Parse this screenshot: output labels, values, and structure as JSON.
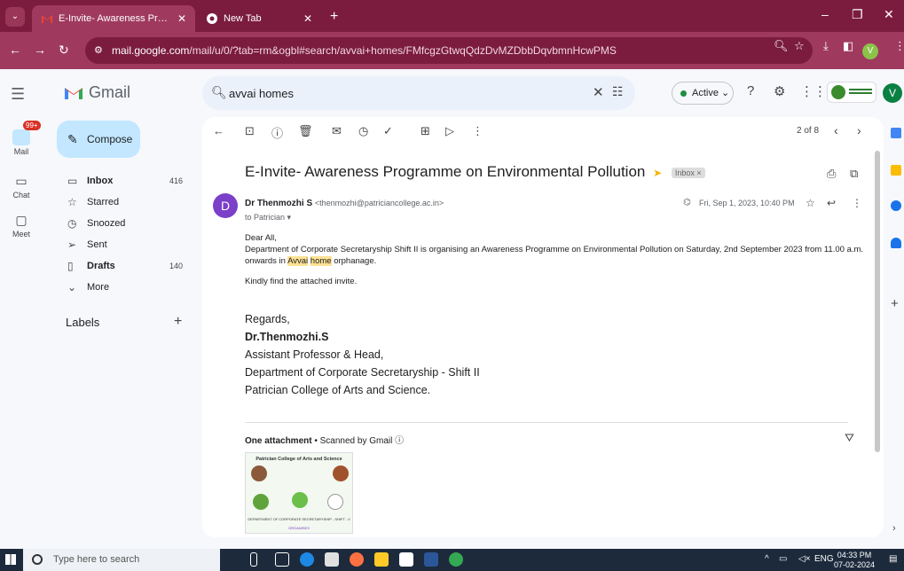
{
  "browser": {
    "tabs": [
      {
        "title": "E-Invite- Awareness Programme",
        "active": true
      },
      {
        "title": "New Tab",
        "active": false
      }
    ],
    "url_host": "mail.google.com",
    "url_path": "/mail/u/0/?tab=rm&ogbl#search/avvai+homes/FMfcgzGtwqQdzDvMZDbbDqvbmnHcwPMS",
    "profile_initial": "V"
  },
  "gmail": {
    "brand": "Gmail",
    "search_value": "avvai homes",
    "status": "Active",
    "avatar": "V",
    "compose": "Compose",
    "rail": {
      "mail": "Mail",
      "mail_badge": "99+",
      "chat": "Chat",
      "meet": "Meet"
    },
    "nav": [
      {
        "label": "Inbox",
        "count": "416",
        "bold": true,
        "icon": "inbox-icon"
      },
      {
        "label": "Starred",
        "count": "",
        "bold": false,
        "icon": "star-icon"
      },
      {
        "label": "Snoozed",
        "count": "",
        "bold": false,
        "icon": "clock-icon"
      },
      {
        "label": "Sent",
        "count": "",
        "bold": false,
        "icon": "send-icon"
      },
      {
        "label": "Drafts",
        "count": "140",
        "bold": true,
        "icon": "draft-icon"
      },
      {
        "label": "More",
        "count": "",
        "bold": false,
        "icon": "chevron-down-icon"
      }
    ],
    "labels_title": "Labels"
  },
  "message": {
    "pager": "2 of 8",
    "subject": "E-Invite- Awareness Programme on Environmental Pollution",
    "inbox_chip": "Inbox ×",
    "sender_initial": "D",
    "sender_name": "Dr Thenmozhi S",
    "sender_email": "<thenmozhi@patriciancollege.ac.in>",
    "to_line": "to Patrician ▾",
    "date": "Fri, Sep 1, 2023, 10:40 PM",
    "greeting": "Dear All,",
    "body_line1": "Department of Corporate Secretaryship Shift II  is organising an Awareness Programme on Environmental Pollution on  Saturday, 2nd September 2023  from 11.00 a.m. onwards in",
    "body_hl1": "Avvai",
    "body_hl2": "home",
    "body_end": "orphanage.",
    "body_line2": "Kindly find the attached invite.",
    "sig": {
      "regards": "Regards,",
      "name": "Dr.Thenmozhi.S",
      "title": "Assistant Professor & Head,",
      "dept": "Department of Corporate Secretaryship - Shift II",
      "college": "Patrician College of Arts and Science."
    },
    "attachment_header": "One attachment",
    "attachment_scan": " • Scanned by Gmail ⓘ",
    "thumb_title": "Patrician College of Arts and Science",
    "thumb_dept": "DEPARTMENT OF CORPORATE SECRETARYSHIP - SHIFT - II",
    "thumb_org": "ORGANISES"
  },
  "taskbar": {
    "search_placeholder": "Type here to search",
    "lang": "ENG",
    "time": "04:33 PM",
    "date": "07-02-2024"
  }
}
